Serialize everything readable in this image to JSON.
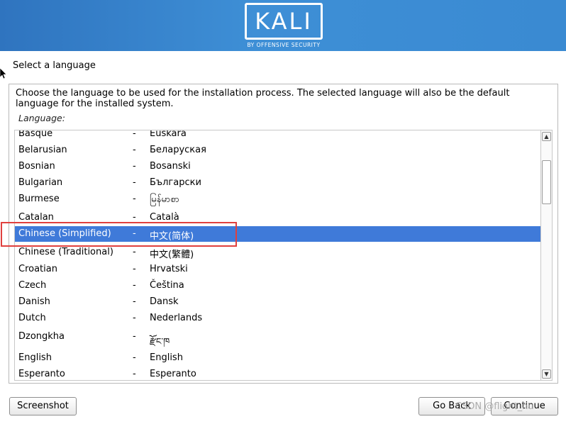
{
  "banner": {
    "logo_text": "KALI",
    "logo_subtext": "BY OFFENSIVE SECURITY",
    "colors": {
      "gradient_start": "#2f74bf",
      "gradient_end": "#3a8ad2"
    }
  },
  "page": {
    "title": "Select a language",
    "description": "Choose the language to be used for the installation process. The selected language will also be the default language for the installed system.",
    "list_label": "Language:"
  },
  "languages": [
    {
      "name": "Basque",
      "sep": "-",
      "native": "Euskara",
      "selected": false
    },
    {
      "name": "Belarusian",
      "sep": "-",
      "native": "Беларуская",
      "selected": false
    },
    {
      "name": "Bosnian",
      "sep": "-",
      "native": "Bosanski",
      "selected": false
    },
    {
      "name": "Bulgarian",
      "sep": "-",
      "native": "Български",
      "selected": false
    },
    {
      "name": "Burmese",
      "sep": "-",
      "native": "မြန်မာစာ",
      "selected": false
    },
    {
      "name": "Catalan",
      "sep": "-",
      "native": "Català",
      "selected": false
    },
    {
      "name": "Chinese (Simplified)",
      "sep": "-",
      "native": "中文(简体)",
      "selected": true
    },
    {
      "name": "Chinese (Traditional)",
      "sep": "-",
      "native": "中文(繁體)",
      "selected": false
    },
    {
      "name": "Croatian",
      "sep": "-",
      "native": "Hrvatski",
      "selected": false
    },
    {
      "name": "Czech",
      "sep": "-",
      "native": "Čeština",
      "selected": false
    },
    {
      "name": "Danish",
      "sep": "-",
      "native": "Dansk",
      "selected": false
    },
    {
      "name": "Dutch",
      "sep": "-",
      "native": "Nederlands",
      "selected": false
    },
    {
      "name": "Dzongkha",
      "sep": "-",
      "native": "རྫོང་ཁ",
      "selected": false
    },
    {
      "name": "English",
      "sep": "-",
      "native": "English",
      "selected": false
    },
    {
      "name": "Esperanto",
      "sep": "-",
      "native": "Esperanto",
      "selected": false
    }
  ],
  "scrollbar": {
    "up_icon": "arrow-up-icon",
    "down_icon": "arrow-down-icon"
  },
  "buttons": {
    "screenshot": "Screenshot",
    "go_back": "Go Back",
    "continue": "Continue"
  },
  "watermark": "CSDN @flight_hu",
  "colors": {
    "selection": "#3f7ad9",
    "annotation_box": "#e0403e"
  }
}
